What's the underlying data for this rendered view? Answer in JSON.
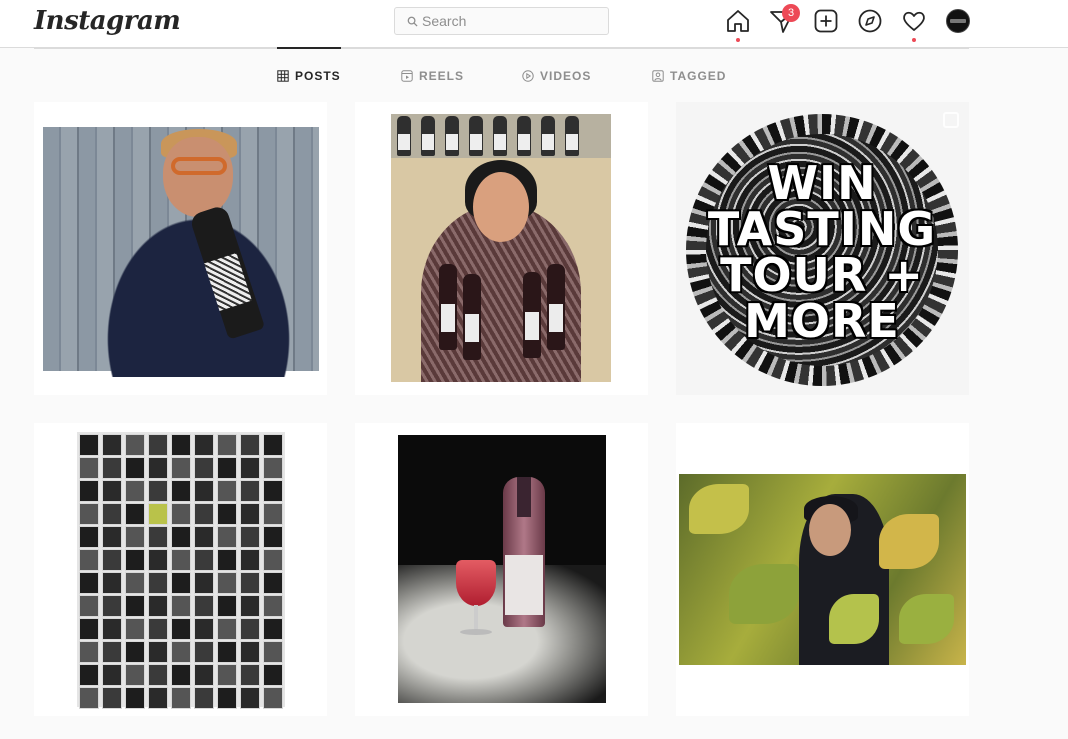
{
  "app": {
    "logo": "Instagram"
  },
  "search": {
    "placeholder": "Search",
    "value": ""
  },
  "nav": {
    "icons": [
      "home-icon",
      "direct-icon",
      "new-post-icon",
      "explore-icon",
      "activity-icon",
      "profile-avatar"
    ],
    "direct_badge": "3"
  },
  "tabs": [
    {
      "label": "POSTS",
      "active": true,
      "icon": "grid-icon"
    },
    {
      "label": "REELS",
      "active": false,
      "icon": "reels-icon"
    },
    {
      "label": "VIDEOS",
      "active": false,
      "icon": "video-icon"
    },
    {
      "label": "TAGGED",
      "active": false,
      "icon": "tagged-icon"
    }
  ],
  "posts": [
    {
      "description": "man-biting-wine-bottle"
    },
    {
      "description": "woman-holding-wine-bottles"
    },
    {
      "text_lines": [
        "WIN",
        "TASTING",
        "TOUR +",
        "MORE"
      ],
      "multi": true
    },
    {
      "description": "wall-of-wine-labels"
    },
    {
      "description": "wine-bottle-and-glass"
    },
    {
      "description": "man-in-vineyard"
    }
  ],
  "colors": {
    "accent": "#ed4956",
    "border": "#dbdbdb",
    "text": "#262626",
    "muted": "#8e8e8e"
  }
}
